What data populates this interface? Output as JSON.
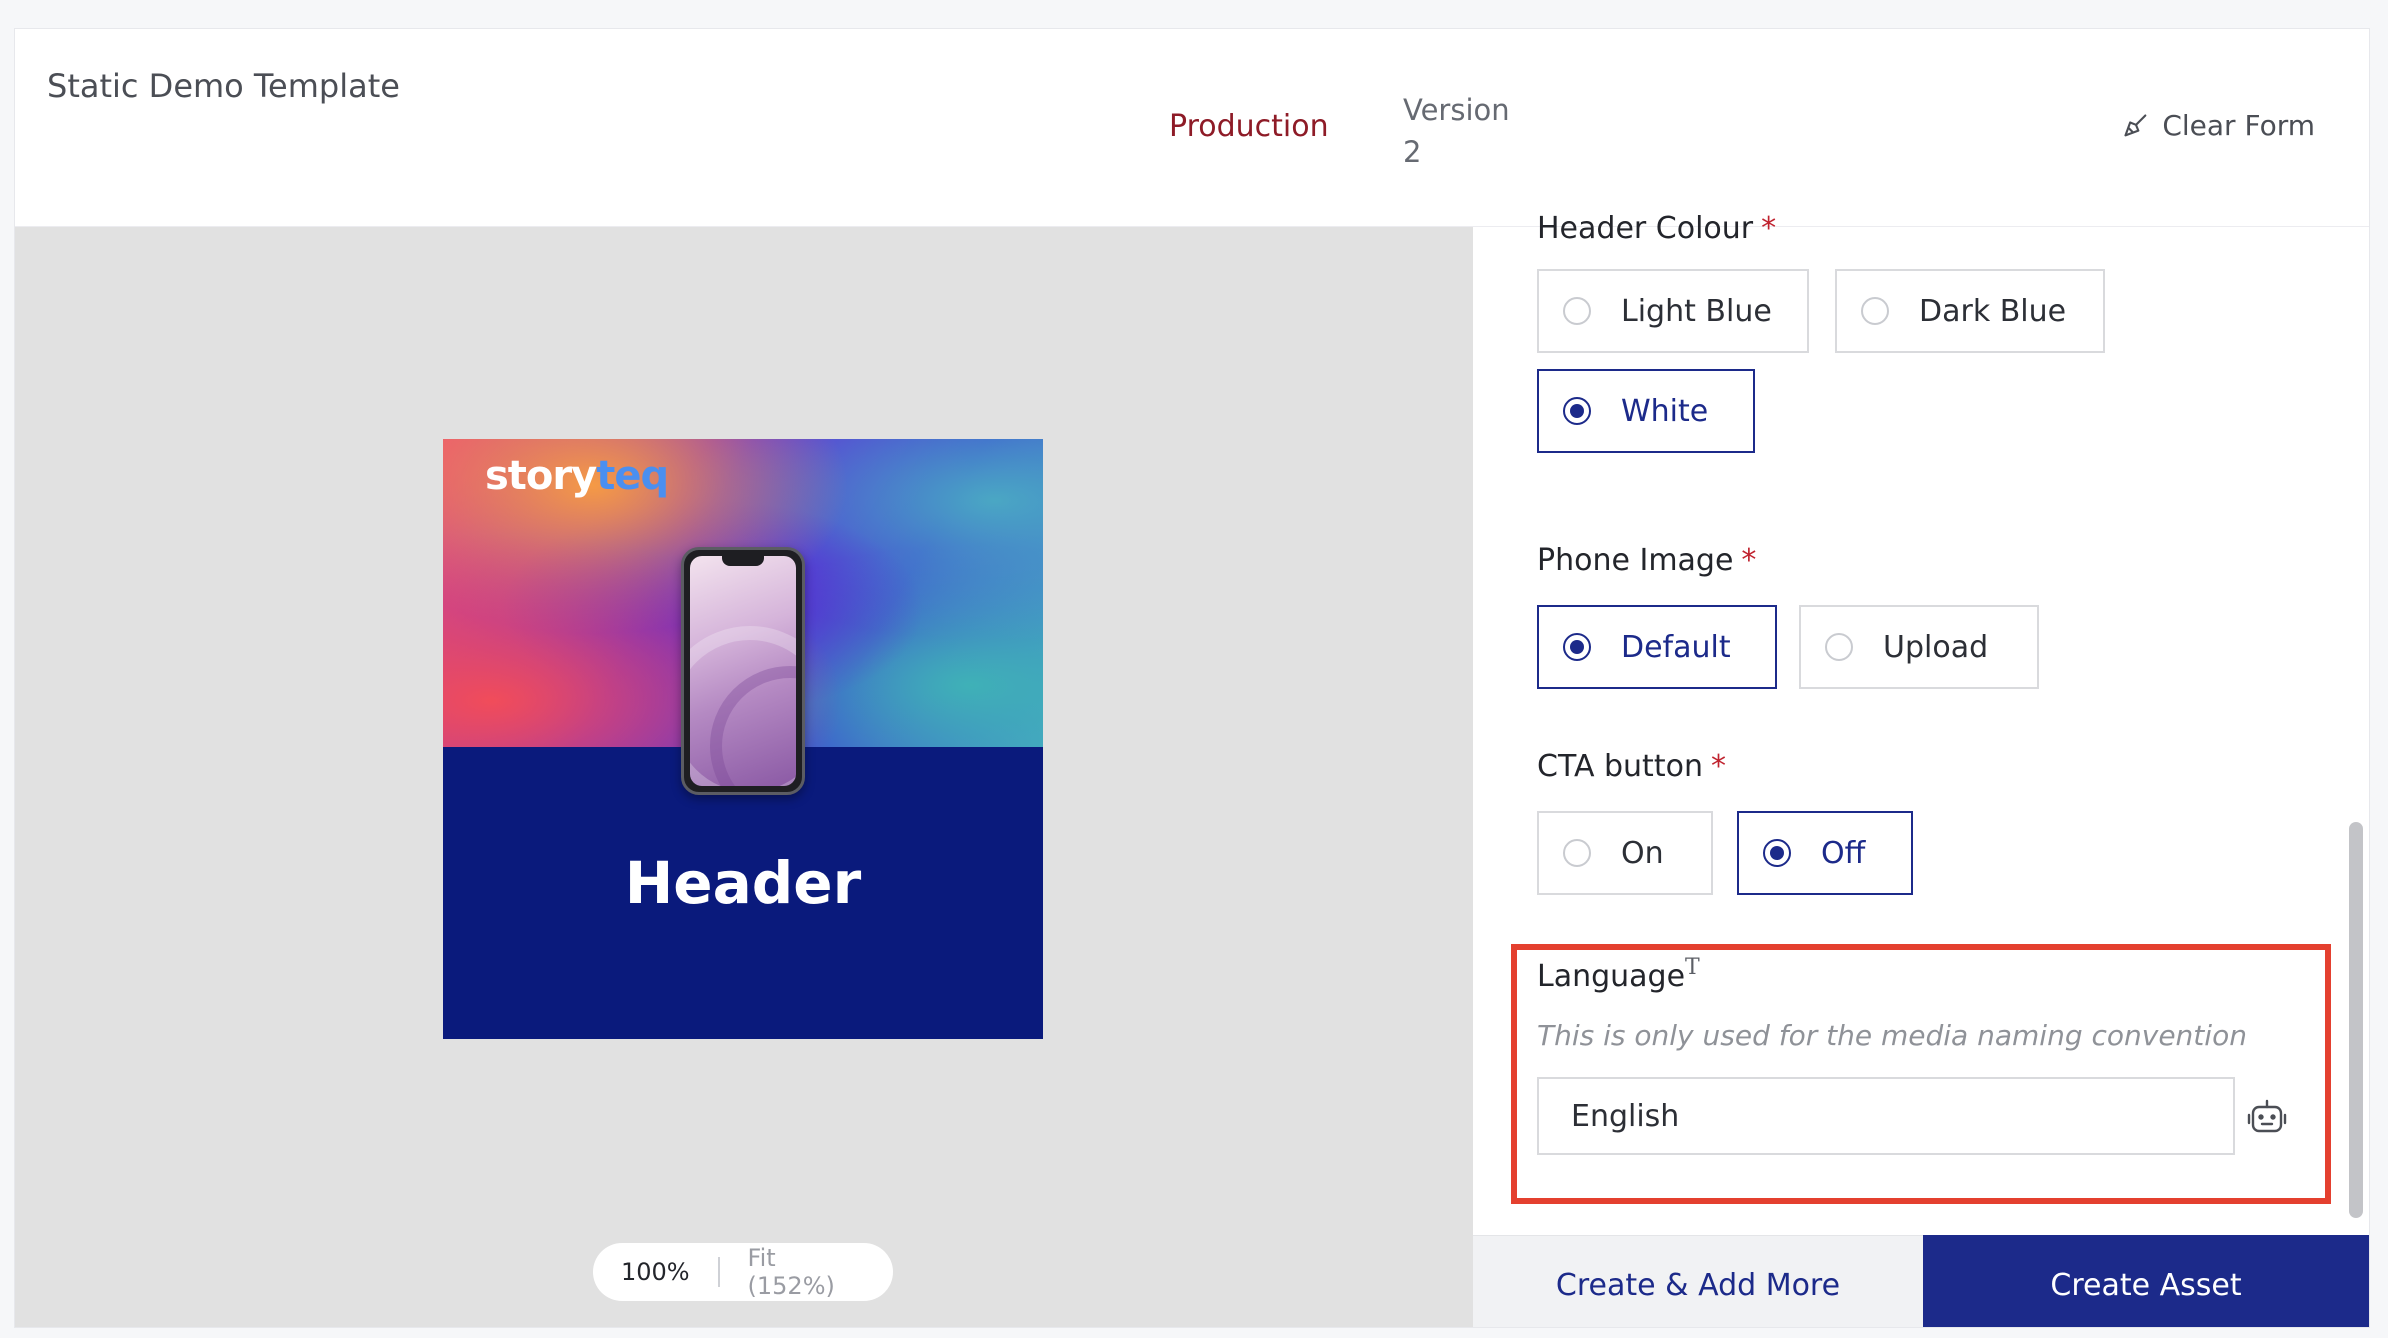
{
  "header": {
    "template_title": "Static Demo Template",
    "environment": "Production",
    "version_label": "Version",
    "version_value": "2",
    "clear_form": "Clear Form"
  },
  "preview": {
    "logo_part1": "story",
    "logo_part2": "teq",
    "canvas_header": "Header",
    "zoom_current": "100%",
    "zoom_fit": "Fit (152%)"
  },
  "form": {
    "header_colour": {
      "label": "Header Colour",
      "required_mark": "*",
      "options": [
        "Light Blue",
        "Dark Blue",
        "White"
      ],
      "selected": "White"
    },
    "phone_image": {
      "label": "Phone Image",
      "required_mark": "*",
      "options": [
        "Default",
        "Upload"
      ],
      "selected": "Default"
    },
    "cta_button": {
      "label": "CTA button",
      "required_mark": "*",
      "options": [
        "On",
        "Off"
      ],
      "selected": "Off"
    },
    "language": {
      "label": "Language",
      "type_icon": "T",
      "hint": "This is only used for the media naming convention",
      "value": "English"
    }
  },
  "footer": {
    "create_add_more": "Create & Add More",
    "create_asset": "Create Asset"
  },
  "colors": {
    "brand_navy": "#1c2a8a",
    "environment_red": "#8e1b27",
    "highlight": "#e4402f"
  },
  "icons": {
    "clear_form": "broom-icon",
    "language_assistant": "robot-icon",
    "language_type": "text-type-icon"
  }
}
